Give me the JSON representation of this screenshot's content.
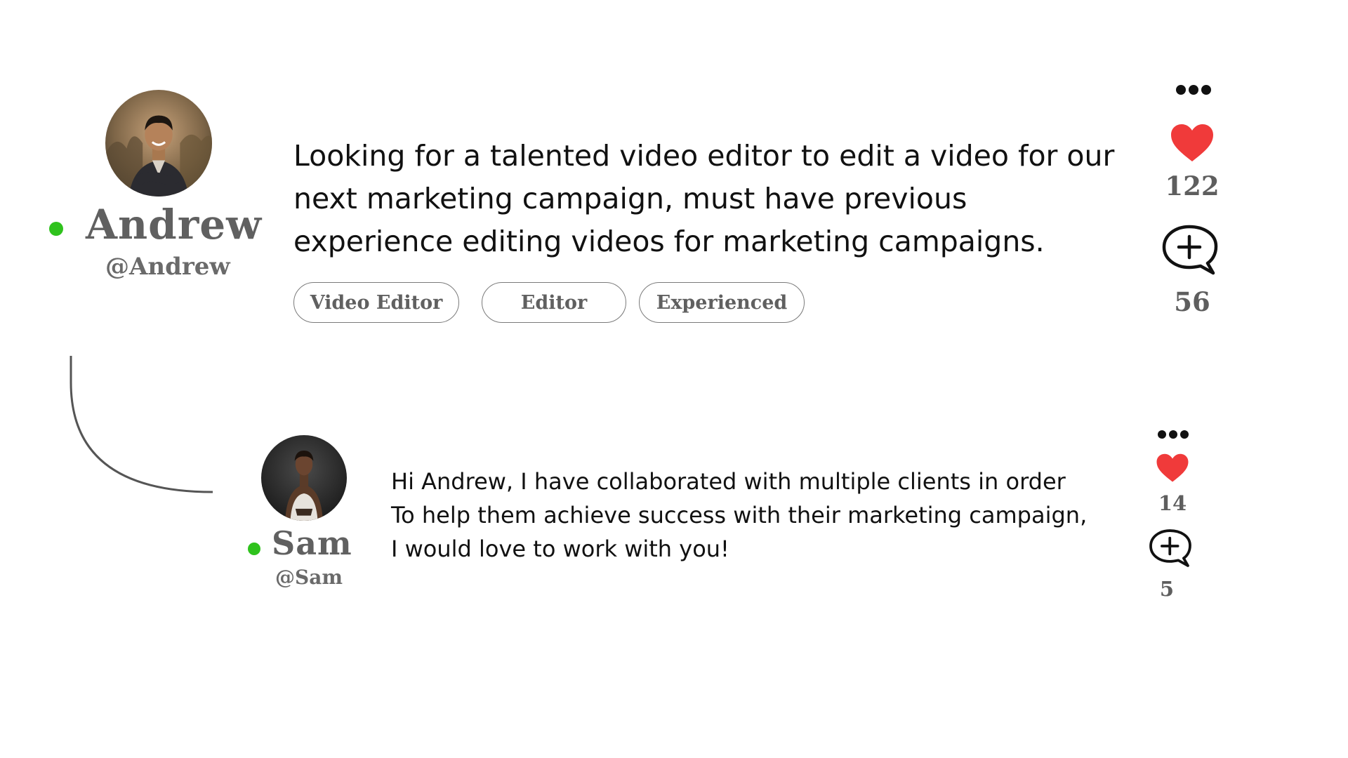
{
  "post": {
    "author": {
      "name": "Andrew",
      "handle": "@Andrew",
      "online": true
    },
    "text_lines": [
      "Looking for a talented video editor to edit a video for our",
      "next marketing campaign,  must have previous",
      "experience editing videos for marketing campaigns."
    ],
    "tags": [
      "Video Editor",
      "Editor",
      "Experienced"
    ],
    "likes": "122",
    "comments": "56"
  },
  "reply": {
    "author": {
      "name": "Sam",
      "handle": "@Sam",
      "online": true
    },
    "text_lines": [
      "Hi Andrew, I have collaborated with multiple clients in order",
      "To help them achieve success with their marketing campaign,",
      "I would love to work with you!"
    ],
    "likes": "14",
    "comments": "5"
  },
  "colors": {
    "online": "#2fc21d",
    "heart": "#f03a3a",
    "muted_text": "#606060"
  },
  "icons": {
    "more": "more-dots-icon",
    "like": "heart-icon",
    "comment": "comment-plus-icon"
  }
}
